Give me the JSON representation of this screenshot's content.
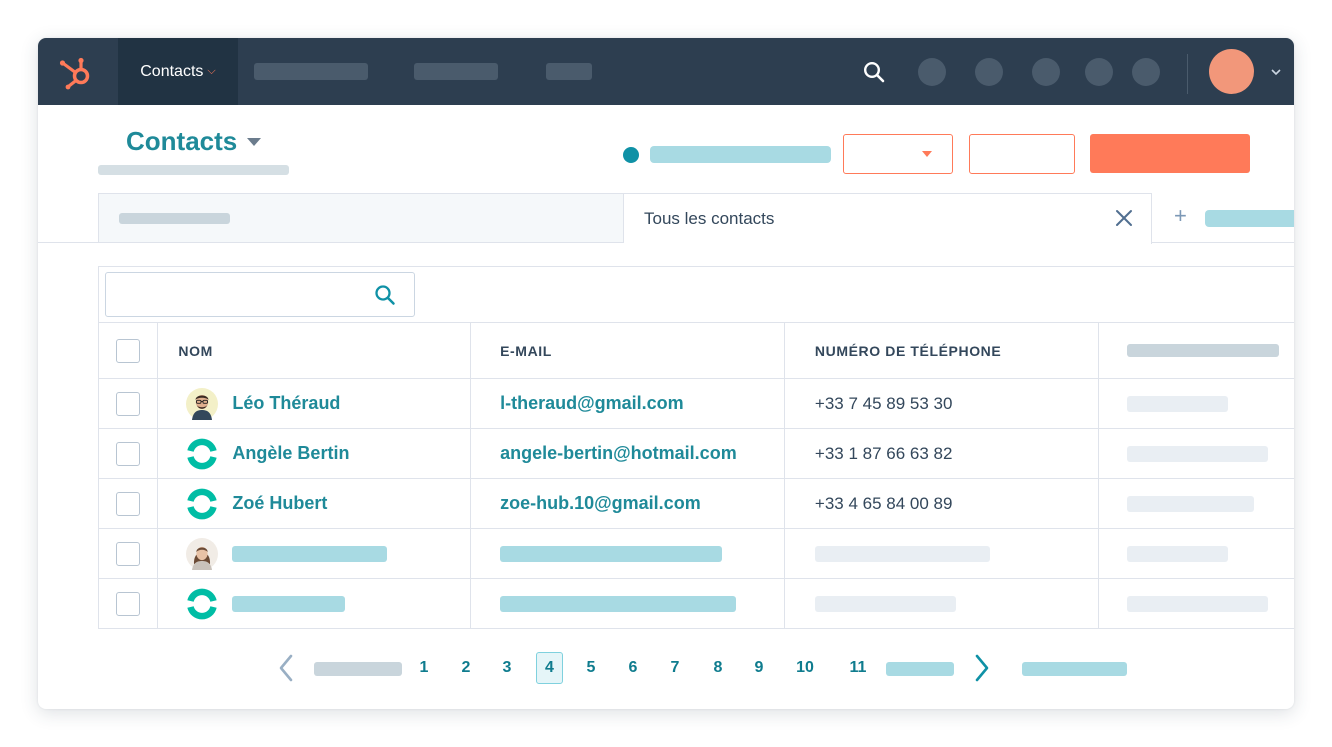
{
  "colors": {
    "nav_bg": "#2d3e50",
    "accent": "#ff7a59",
    "link": "#1f8a99",
    "text": "#33475b"
  },
  "topnav": {
    "logo_icon": "hubspot-sprocket-icon",
    "menu_label": "Contacts",
    "menu_caret": "⌵",
    "search_icon": "search-icon"
  },
  "header": {
    "title": "Contacts"
  },
  "tabs": {
    "active_label": "Tous les contacts",
    "close_icon": "close-icon",
    "add_label": "+"
  },
  "search": {
    "value": "",
    "placeholder": ""
  },
  "table": {
    "headers": {
      "name": "NOM",
      "email": "E-MAIL",
      "phone": "NUMÉRO DE TÉLÉPHONE"
    },
    "rows": [
      {
        "avatar": "man-avatar-icon",
        "name": "Léo Théraud",
        "email": "l-theraud@gmail.com",
        "phone": "+33 7 45 89 53 30"
      },
      {
        "avatar": "hubspot-contact-icon",
        "name": "Angèle Bertin",
        "email": "angele-bertin@hotmail.com",
        "phone": "+33 1 87 66 63 82"
      },
      {
        "avatar": "hubspot-contact-icon",
        "name": "Zoé Hubert",
        "email": "zoe-hub.10@gmail.com",
        "phone": "+33 4 65 84 00 89"
      },
      {
        "avatar": "woman-avatar-icon",
        "name": "",
        "email": "",
        "phone": ""
      },
      {
        "avatar": "hubspot-contact-icon",
        "name": "",
        "email": "",
        "phone": ""
      }
    ]
  },
  "pagination": {
    "pages": [
      "1",
      "2",
      "3",
      "4",
      "5",
      "6",
      "7",
      "8",
      "9",
      "10",
      "11"
    ],
    "current": "4",
    "prev_icon": "chevron-left-icon",
    "next_icon": "chevron-right-icon"
  }
}
